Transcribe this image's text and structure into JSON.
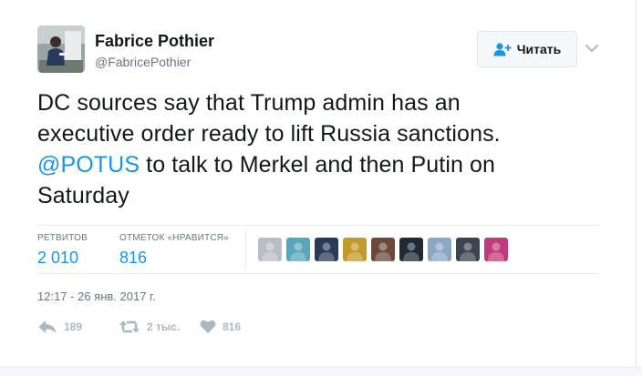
{
  "author": {
    "name": "Fabrice Pothier",
    "handle": "@FabricePothier"
  },
  "follow_button": {
    "label": "Читать",
    "icon": "follow-person-plus-icon"
  },
  "menu": {
    "icon": "chevron-down-icon"
  },
  "tweet": {
    "lines": [
      "DC sources say that Trump admin has an",
      "executive order ready to lift Russia sanctions."
    ],
    "line3_mention": "@POTUS",
    "line3_rest": " to talk to Merkel and then Putin on",
    "line4": "Saturday"
  },
  "stats": {
    "retweets_label": "РЕТВИТОВ",
    "retweets_value": "2 010",
    "likes_label": "ОТМЕТОК «НРАВИТСЯ»",
    "likes_value": "816"
  },
  "likers": [
    {
      "icon": "liker-avatar-icon",
      "color": "#b9bec4"
    },
    {
      "icon": "liker-avatar-icon",
      "color": "#5aa6b8"
    },
    {
      "icon": "liker-avatar-icon",
      "color": "#2b3b55"
    },
    {
      "icon": "liker-avatar-icon",
      "color": "#c49a2a"
    },
    {
      "icon": "liker-avatar-icon",
      "color": "#6b4a3a"
    },
    {
      "icon": "liker-avatar-icon",
      "color": "#1f2a36"
    },
    {
      "icon": "liker-avatar-icon",
      "color": "#8aa7c4"
    },
    {
      "icon": "liker-avatar-icon",
      "color": "#3c4452"
    },
    {
      "icon": "liker-avatar-icon",
      "color": "#c23a7a"
    }
  ],
  "timestamp": "12:17 - 26 янв. 2017 г.",
  "actions": {
    "reply_count": "189",
    "retweet_count": "2 тыс.",
    "like_count": "816"
  },
  "colors": {
    "link": "#1b95e0",
    "muted": "#657786",
    "action_gray": "#aab8c2",
    "divider": "#e6ecf0"
  }
}
